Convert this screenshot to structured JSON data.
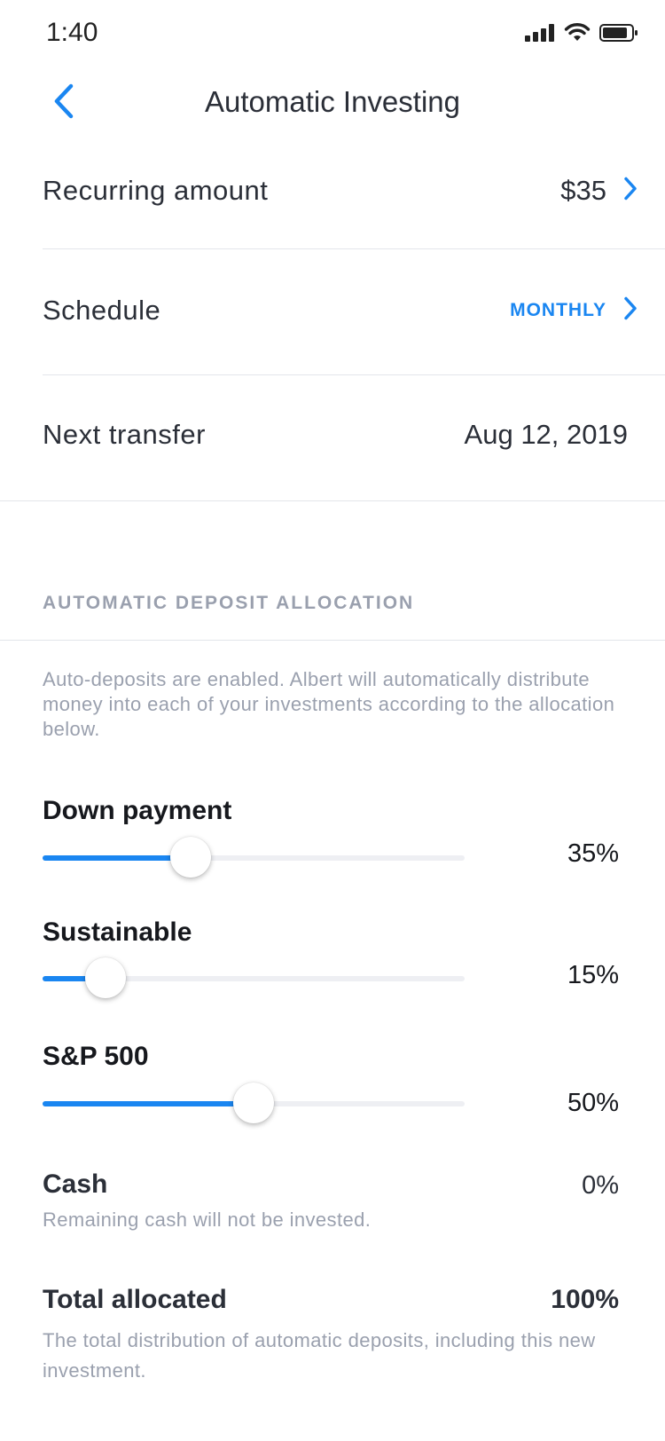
{
  "status_bar": {
    "time": "1:40"
  },
  "nav": {
    "title": "Automatic Investing"
  },
  "settings": {
    "recurring_amount": {
      "label": "Recurring amount",
      "value": "$35"
    },
    "schedule": {
      "label": "Schedule",
      "value": "MONTHLY"
    },
    "next_transfer": {
      "label": "Next transfer",
      "value": "Aug 12, 2019"
    }
  },
  "allocation": {
    "header": "AUTOMATIC DEPOSIT ALLOCATION",
    "description": "Auto-deposits are enabled. Albert will automatically distribute money into each of your investments according to the allocation below.",
    "items": [
      {
        "name": "Down payment",
        "percent_label": "35%",
        "percent": 35
      },
      {
        "name": "Sustainable",
        "percent_label": "15%",
        "percent": 15
      },
      {
        "name": "S&P 500",
        "percent_label": "50%",
        "percent": 50
      }
    ],
    "cash": {
      "name": "Cash",
      "percent_label": "0%",
      "note": "Remaining cash will not be invested."
    },
    "total": {
      "name": "Total allocated",
      "percent_label": "100%",
      "note": "The total distribution of automatic deposits, including this new investment."
    }
  },
  "colors": {
    "accent": "#1a86f1",
    "muted_text": "#9aa0ae",
    "track": "#eeeff3"
  }
}
